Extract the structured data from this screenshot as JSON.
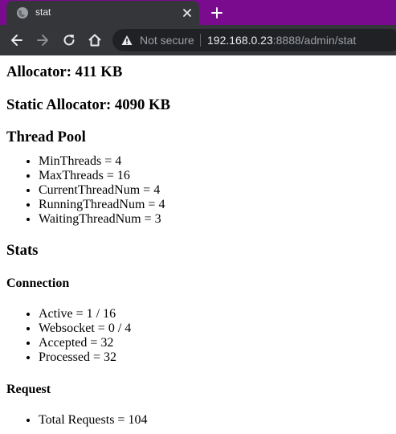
{
  "browser": {
    "tab_title": "stat",
    "security_label": "Not secure",
    "url_host": "192.168.0.23",
    "url_rest": ":8888/admin/stat"
  },
  "page": {
    "allocator": "Allocator: 411 KB",
    "static_allocator": "Static Allocator: 4090 KB",
    "thread_pool": {
      "heading": "Thread Pool",
      "items": [
        "MinThreads = 4",
        "MaxThreads = 16",
        "CurrentThreadNum = 4",
        "RunningThreadNum = 4",
        "WaitingThreadNum = 3"
      ]
    },
    "stats": {
      "heading": "Stats",
      "connection": {
        "heading": "Connection",
        "items": [
          "Active = 1 / 16",
          "Websocket = 0 / 4",
          "Accepted = 32",
          "Processed = 32"
        ]
      },
      "request": {
        "heading": "Request",
        "items": [
          "Total Requests = 104"
        ]
      }
    }
  }
}
